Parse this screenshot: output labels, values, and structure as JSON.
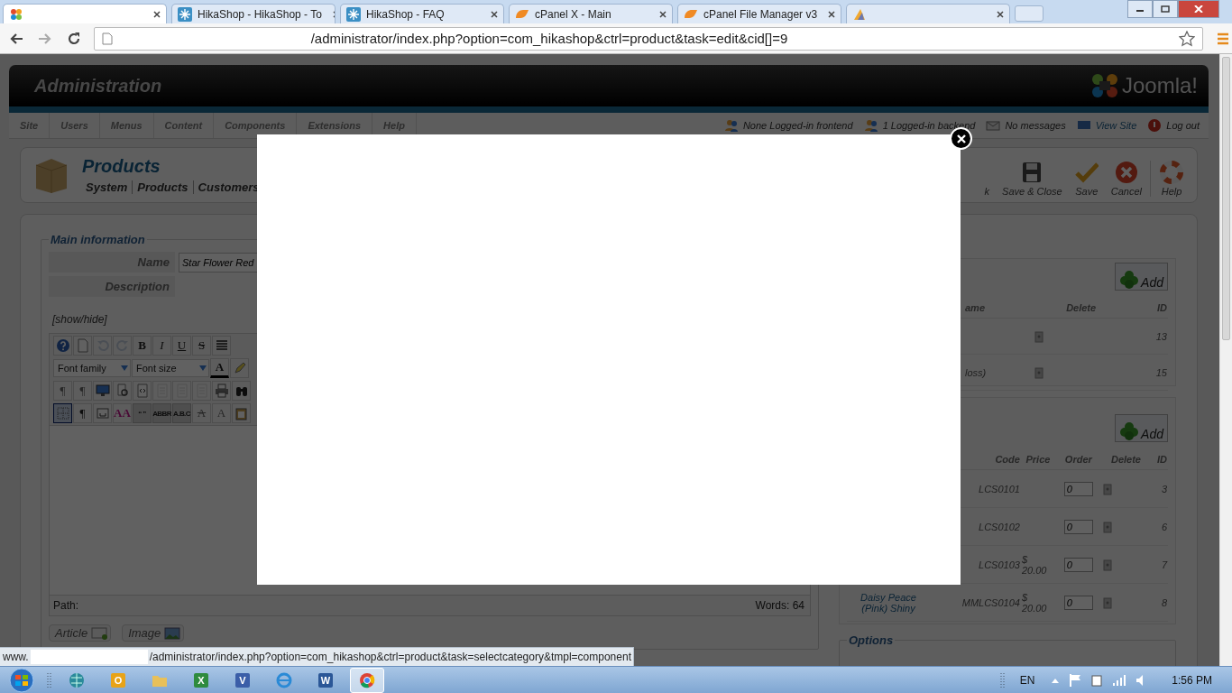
{
  "browser": {
    "tabs": [
      {
        "selected": true
      },
      {
        "title": "HikaShop - HikaShop - To",
        "selected": false
      },
      {
        "title": "HikaShop - FAQ",
        "selected": false
      },
      {
        "title": "cPanel X - Main",
        "selected": false
      },
      {
        "title": "cPanel File Manager v3",
        "selected": false
      },
      {
        "selected": false
      }
    ],
    "address": "/administrator/index.php?option=com_hikashop&ctrl=product&task=edit&cid[]=9"
  },
  "admin": {
    "title": "Administration",
    "logo": "Joomla!",
    "menu": [
      "Site",
      "Users",
      "Menus",
      "Content",
      "Components",
      "Extensions",
      "Help"
    ],
    "status": [
      {
        "label": "None Logged-in frontend",
        "link": false
      },
      {
        "label": "1 Logged-in backend",
        "link": false
      },
      {
        "label": "No messages",
        "link": false
      },
      {
        "label": "View Site",
        "link": true
      },
      {
        "label": "Log out",
        "link": false
      }
    ]
  },
  "toolbar": {
    "title": "Products",
    "submenu": [
      "System",
      "Products",
      "Customers"
    ],
    "buttons": [
      {
        "label": "k"
      },
      {
        "label": "Save & Close"
      },
      {
        "label": "Save"
      },
      {
        "label": "Cancel"
      },
      {
        "label": "Help"
      }
    ]
  },
  "main_information": {
    "legend": "Main information",
    "name_label": "Name",
    "name_value": "Star Flower Red",
    "description_label": "Description",
    "toggle": "[show/hide]",
    "editor": {
      "toolbar_rows": [
        [
          {
            "kind": "help",
            "disabled": false
          },
          {
            "kind": "page",
            "disabled": false
          },
          {
            "kind": "undo",
            "disabled": true
          },
          {
            "kind": "redo",
            "disabled": true
          },
          {
            "kind": "bold",
            "label": "B",
            "disabled": false
          },
          {
            "kind": "italic",
            "label": "I",
            "disabled": false
          },
          {
            "kind": "underline",
            "label": "U",
            "disabled": false
          },
          {
            "kind": "strike",
            "label": "S",
            "disabled": false
          },
          {
            "kind": "justify",
            "disabled": false
          }
        ],
        [
          {
            "kind": "select",
            "label": "Font family"
          },
          {
            "kind": "select",
            "label": "Font size"
          },
          {
            "kind": "color",
            "label": "A"
          },
          {
            "kind": "highlighter"
          }
        ],
        [
          {
            "kind": "plain",
            "label": "¶",
            "disabled": true
          },
          {
            "kind": "plain",
            "label": "¶",
            "disabled": true
          },
          {
            "kind": "monitor",
            "disabled": false
          },
          {
            "kind": "preview",
            "disabled": false
          },
          {
            "kind": "code",
            "disabled": false
          },
          {
            "kind": "doc",
            "disabled": true
          },
          {
            "kind": "doc",
            "disabled": true
          },
          {
            "kind": "doc",
            "disabled": true
          },
          {
            "kind": "printer",
            "disabled": false
          },
          {
            "kind": "binoculars",
            "disabled": false
          }
        ],
        [
          {
            "kind": "grid",
            "disabled": false,
            "active": true
          },
          {
            "kind": "plain",
            "label": "¶",
            "disabled": false,
            "active": false
          },
          {
            "kind": "box",
            "disabled": false,
            "active": false
          },
          {
            "kind": "styles",
            "label": "AA",
            "disabled": false,
            "active": false
          },
          {
            "kind": "tiny",
            "label": "“ ”",
            "disabled": true,
            "active": false
          },
          {
            "kind": "tiny",
            "label": "ABBR",
            "disabled": true,
            "active": false
          },
          {
            "kind": "tiny",
            "label": "A.B.C",
            "disabled": true,
            "active": false
          },
          {
            "kind": "strike",
            "label": "A",
            "disabled": true,
            "active": false
          },
          {
            "kind": "plain",
            "label": "A",
            "disabled": true,
            "active": false
          },
          {
            "kind": "clipboard",
            "disabled": false,
            "active": false
          }
        ]
      ],
      "path_label": "Path:",
      "word_count": "Words: 64"
    },
    "buttons": [
      {
        "label": "Article"
      },
      {
        "label": "Image"
      }
    ]
  },
  "categories": {
    "add": "Add",
    "columns": [
      "ame",
      "Delete",
      "ID"
    ],
    "rows": [
      {
        "id": "13"
      },
      {
        "name": "loss)",
        "id": "15"
      }
    ]
  },
  "variants": {
    "add": "Add",
    "columns": [
      "Code",
      "Price",
      "Order",
      "Delete",
      "ID"
    ],
    "rows": [
      {
        "code": "LCS0101",
        "order": "0",
        "id": "3"
      },
      {
        "code": "LCS0102",
        "order": "0",
        "id": "6"
      },
      {
        "code": "LCS0103",
        "price": "$ 20.00",
        "order": "0",
        "id": "7"
      },
      {
        "name": "Daisy Peace (Pink) Shiny",
        "code": "MMLCS0104",
        "price": "$ 20.00",
        "order": "0",
        "id": "8"
      }
    ]
  },
  "options": {
    "legend": "Options"
  },
  "modal": {
    "open": true
  },
  "status_url": {
    "prefix": "www.",
    "path": "/administrator/index.php?option=com_hikashop&ctrl=product&task=selectcategory&tmpl=component"
  },
  "taskbar": {
    "apps": [
      {
        "kind": "globe",
        "selected": false
      },
      {
        "kind": "tile",
        "label": "O",
        "color": "#e8a317",
        "selected": false
      },
      {
        "kind": "folder",
        "selected": false
      },
      {
        "kind": "tile",
        "label": "X",
        "color": "#2e8b3e",
        "selected": false
      },
      {
        "kind": "tile",
        "label": "V",
        "color": "#3b5ea8",
        "selected": false
      },
      {
        "kind": "ie",
        "selected": false
      },
      {
        "kind": "tile",
        "label": "W",
        "color": "#2b5797",
        "selected": false
      },
      {
        "kind": "chrome",
        "selected": true
      }
    ],
    "language": "EN",
    "clock": "1:56 PM"
  }
}
